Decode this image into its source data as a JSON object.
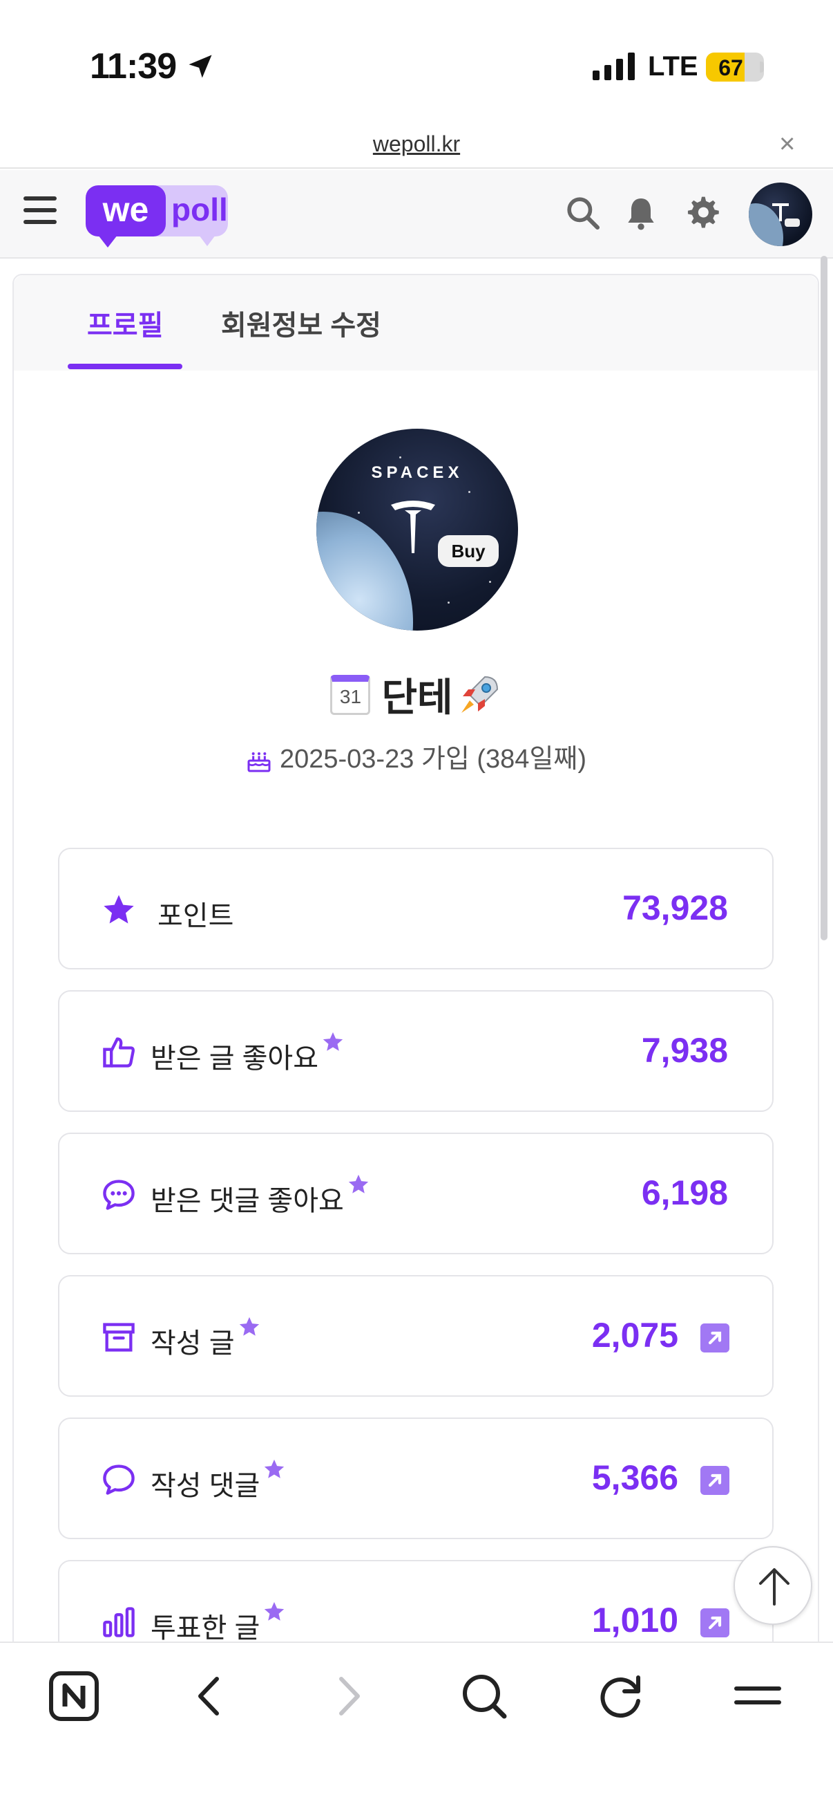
{
  "status_bar": {
    "time": "11:39",
    "network": "LTE",
    "battery": "67",
    "battery_level": 0.67
  },
  "browser": {
    "url": "wepoll.kr",
    "close_glyph": "×"
  },
  "header": {
    "logo_we": "we",
    "logo_poll": "poll",
    "icons": [
      "menu-icon",
      "search-icon",
      "bell-icon",
      "gear-icon",
      "avatar"
    ]
  },
  "tabs": {
    "profile": "프로필",
    "edit": "회원정보 수정"
  },
  "profile": {
    "avatar_text": "SPACEX",
    "avatar_badge": "Buy",
    "calendar_day": "31",
    "name": "단테",
    "joined": "2025-03-23 가입 (384일째)"
  },
  "stats": [
    {
      "icon": "star-icon",
      "label": "포인트",
      "value": "73,928",
      "starred": false,
      "link": false
    },
    {
      "icon": "thumbs-up-icon",
      "label": "받은 글 좋아요",
      "value": "7,938",
      "starred": true,
      "link": false
    },
    {
      "icon": "comment-dots-icon",
      "label": "받은 댓글 좋아요",
      "value": "6,198",
      "starred": true,
      "link": false
    },
    {
      "icon": "archive-icon",
      "label": "작성 글",
      "value": "2,075",
      "starred": true,
      "link": true
    },
    {
      "icon": "comment-icon",
      "label": "작성 댓글",
      "value": "5,366",
      "starred": true,
      "link": true
    },
    {
      "icon": "bar-chart-icon",
      "label": "투표한 글",
      "value": "1,010",
      "starred": true,
      "link": true
    }
  ],
  "colors": {
    "accent": "#7b2ff2",
    "accent_light": "#a178f4",
    "battery": "#f7c800"
  },
  "bottom_bar": [
    "naver-home-icon",
    "back-icon",
    "forward-icon",
    "search-icon",
    "refresh-icon",
    "menu-icon"
  ]
}
